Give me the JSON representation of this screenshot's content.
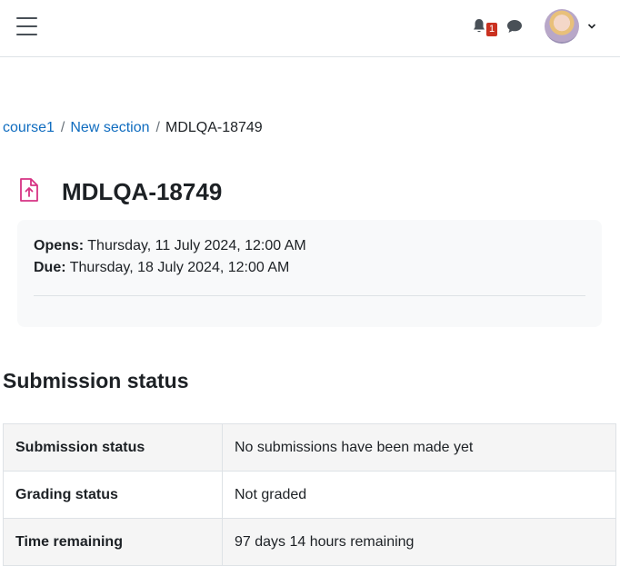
{
  "navbar": {
    "notification_count": "1"
  },
  "breadcrumb": {
    "items": [
      "course1",
      "New section"
    ],
    "current": "MDLQA-18749"
  },
  "page": {
    "title": "MDLQA-18749",
    "icon": "assignment-upload-icon",
    "icon_color": "#d63384"
  },
  "dates": {
    "opens_label": "Opens:",
    "opens_value": "Thursday, 11 July 2024, 12:00 AM",
    "due_label": "Due:",
    "due_value": "Thursday, 18 July 2024, 12:00 AM"
  },
  "submission": {
    "heading": "Submission status",
    "rows": [
      {
        "label": "Submission status",
        "value": "No submissions have been made yet"
      },
      {
        "label": "Grading status",
        "value": "Not graded"
      },
      {
        "label": "Time remaining",
        "value": "97 days 14 hours remaining"
      }
    ]
  },
  "colors": {
    "link": "#0f6cbf",
    "badge": "#ca3120"
  }
}
